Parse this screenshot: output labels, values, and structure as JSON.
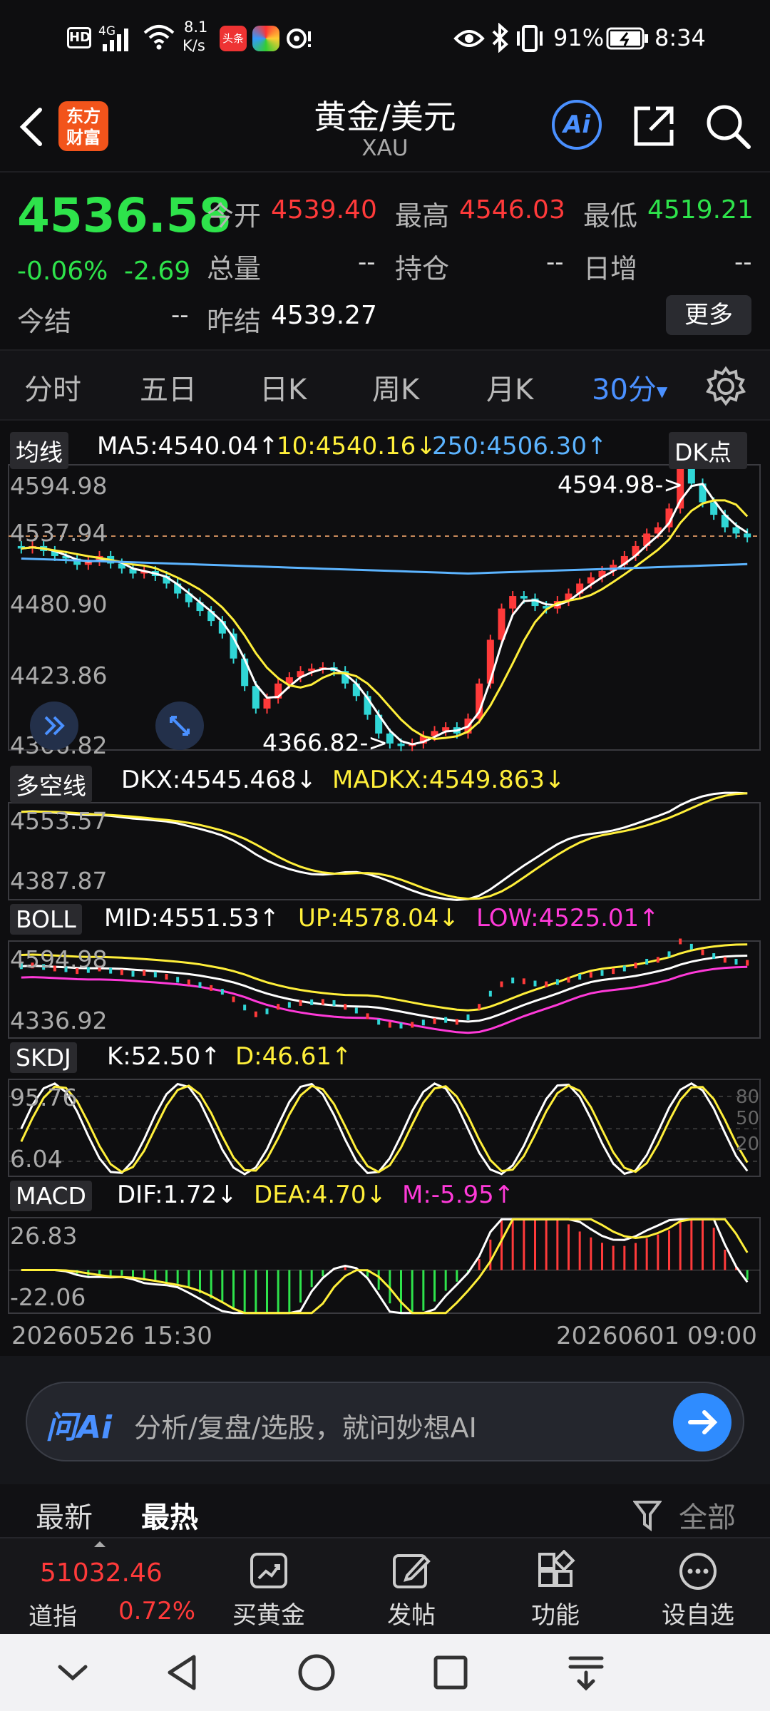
{
  "status_bar": {
    "hd": "HD",
    "signal": "4G",
    "speed_top": "8.1",
    "speed_bottom": "K/s",
    "app_badge": "头条",
    "battery": "91%",
    "time": "8:34"
  },
  "nav": {
    "logo_line1": "东方",
    "logo_line2": "财富",
    "title": "黄金/美元",
    "subtitle": "XAU",
    "ai_label": "Ai"
  },
  "quote": {
    "price": "4536.58",
    "change_pct": "-0.06%",
    "change": "-2.69",
    "open_label": "今开",
    "open": "4539.40",
    "high_label": "最高",
    "high": "4546.03",
    "low_label": "最低",
    "low": "4519.21",
    "volume_label": "总量",
    "volume": "--",
    "position_label": "持仓",
    "position": "--",
    "daily_inc_label": "日增",
    "daily_inc": "--",
    "settle_label": "今结",
    "settle": "--",
    "prev_settle_label": "昨结",
    "prev_settle": "4539.27",
    "more_label": "更多"
  },
  "tabs": {
    "t1": "分时",
    "t2": "五日",
    "t3": "日K",
    "t4": "周K",
    "t5": "月K",
    "t6": "30分"
  },
  "chart_data": [
    {
      "type": "candlestick",
      "title": "均线",
      "ma5": "MA5:4540.04↑",
      "ma10": "10:4540.16↓",
      "ma250": "250:4506.30↑",
      "dk_label": "DK点",
      "y_ticks": [
        "4594.98",
        "4537.94",
        "4480.90",
        "4423.86",
        "4366.82"
      ],
      "ylim": [
        4366.82,
        4594.98
      ],
      "last_close": 4537.94,
      "max_annotation": "4594.98->",
      "min_annotation": "4366.82->",
      "close": [
        4528,
        4530,
        4526,
        4522,
        4520,
        4515,
        4518,
        4522,
        4516,
        4512,
        4508,
        4510,
        4506,
        4500,
        4492,
        4485,
        4478,
        4470,
        4460,
        4440,
        4418,
        4400,
        4408,
        4420,
        4425,
        4430,
        4432,
        4433,
        4430,
        4420,
        4410,
        4395,
        4380,
        4372,
        4370,
        4372,
        4378,
        4382,
        4385,
        4380,
        4392,
        4420,
        4455,
        4480,
        4490,
        4488,
        4482,
        4480,
        4486,
        4492,
        4500,
        4505,
        4510,
        4515,
        4522,
        4530,
        4540,
        4545,
        4560,
        4594,
        4580,
        4565,
        4555,
        4545,
        4540,
        4537
      ]
    },
    {
      "type": "line",
      "title": "多空线",
      "dkx": "DKX:4545.468↓",
      "madkx": "MADKX:4549.863↓",
      "y_ticks": [
        "4553.57",
        "4387.87"
      ],
      "ylim": [
        4387.87,
        4553.57
      ]
    },
    {
      "type": "line",
      "title": "BOLL",
      "mid": "MID:4551.53↑",
      "up": "UP:4578.04↓",
      "low": "LOW:4525.01↑",
      "y_ticks": [
        "4594.98",
        "4336.92"
      ],
      "ylim": [
        4336.92,
        4594.98
      ]
    },
    {
      "type": "line",
      "title": "SKDJ",
      "k": "K:52.50↑",
      "d": "D:46.61↑",
      "y_ticks": [
        "95.76",
        "6.04"
      ],
      "right_ticks": [
        "80",
        "50",
        "20"
      ],
      "ylim": [
        6.04,
        95.76
      ]
    },
    {
      "type": "bar",
      "title": "MACD",
      "dif": "DIF:1.72↓",
      "dea": "DEA:4.70↓",
      "m": "M:-5.95↑",
      "y_ticks": [
        "26.83",
        "-22.06"
      ],
      "ylim": [
        -22.06,
        26.83
      ]
    }
  ],
  "time_axis": {
    "start": "20260526 15:30",
    "end": "20260601 09:00"
  },
  "ai_bar": {
    "label": "问Ai",
    "placeholder": "分析/复盘/选股，就问妙想AI"
  },
  "hot_bar": {
    "latest": "最新",
    "hottest": "最热",
    "all": "全部"
  },
  "bottom": {
    "index_value": "51032.46",
    "index_name": "道指",
    "index_change": "0.72%",
    "buy_gold": "买黄金",
    "post": "发帖",
    "functions": "功能",
    "add_watch": "设自选"
  },
  "colors": {
    "up": "#ff3a3a",
    "down": "#2ee34b",
    "accent": "#4a90ff",
    "ma10": "#ffef3a",
    "ma250": "#5cb4ff",
    "magenta": "#ff3ad9"
  }
}
